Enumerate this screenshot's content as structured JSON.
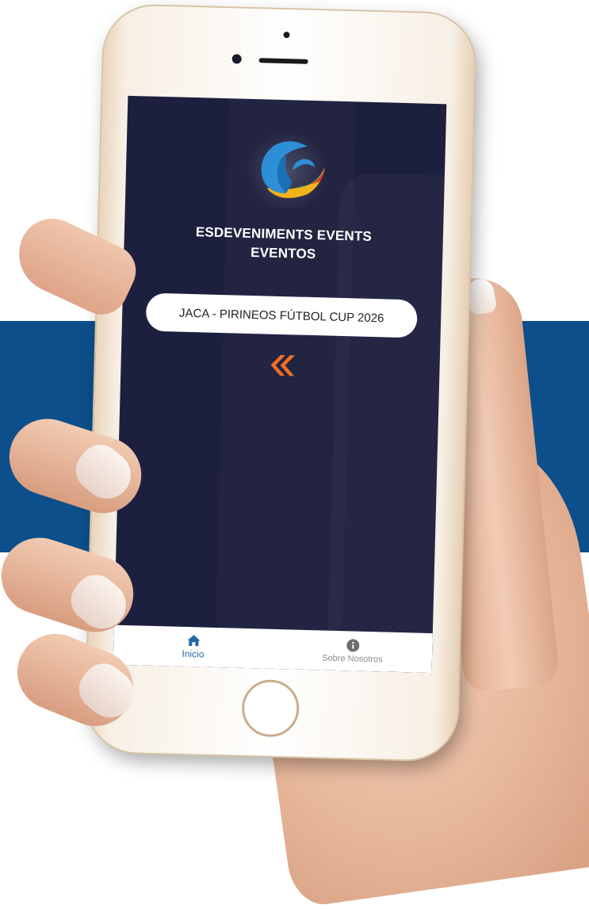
{
  "app": {
    "title_line1": "ESDEVENIMENTS EVENTS",
    "title_line2": "EVENTOS",
    "logo_icon": "esdeveniments-logo-icon"
  },
  "events": [
    {
      "label": "JACA - PIRINEOS FÚTBOL CUP 2026"
    }
  ],
  "back_icon": "double-chevron-left-icon",
  "tabbar": {
    "items": [
      {
        "label": "Inicio",
        "icon": "home-icon",
        "active": true
      },
      {
        "label": "Sobre Nosotros",
        "icon": "info-icon",
        "active": false
      }
    ]
  },
  "colors": {
    "screen_bg": "#1d1f3e",
    "accent_orange": "#f37021",
    "active_tab": "#2469a8",
    "brand_blue": "#0c4f8a"
  }
}
